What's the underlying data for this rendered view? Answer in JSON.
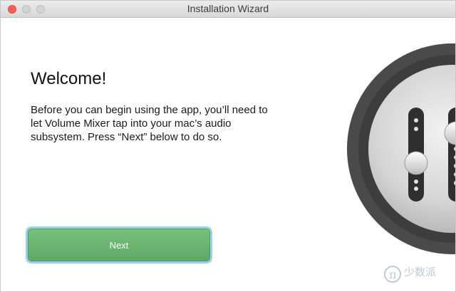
{
  "window": {
    "title": "Installation Wizard"
  },
  "welcome": {
    "heading": "Welcome!",
    "description": "Before you can begin using the app, you’ll need to let Volume Mixer tap into your mac’s audio subsystem. Press “Next” below to do so."
  },
  "buttons": {
    "next_label": "Next"
  },
  "icons": {
    "close": "close-icon",
    "minimize": "minimize-icon",
    "maximize": "maximize-icon",
    "app": "volume-mixer-app-icon"
  },
  "colors": {
    "accent_green": "#66b46d",
    "focus_ring": "#9ccdf1",
    "close_red": "#fc5f57"
  },
  "watermark": {
    "text": "少数派"
  }
}
